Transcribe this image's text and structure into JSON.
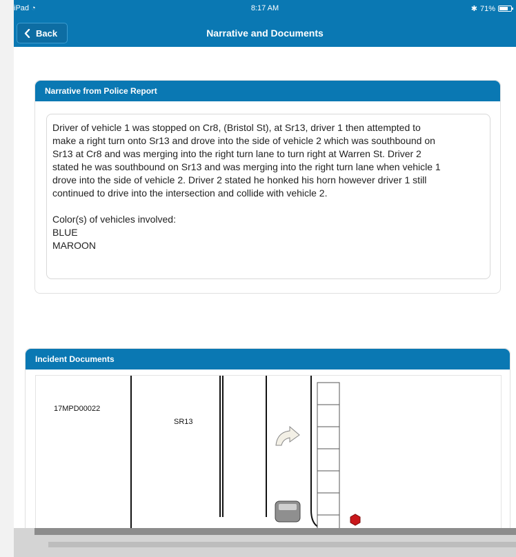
{
  "status_bar": {
    "device": "iPad",
    "time": "8:17 AM",
    "battery": "71%"
  },
  "nav": {
    "back_label": "Back",
    "title": "Narrative and Documents"
  },
  "narrative": {
    "header": "Narrative from Police Report",
    "paragraph_lines": [
      "Driver of vehicle 1 was stopped on Cr8, (Bristol St), at Sr13, driver 1 then attempted to",
      "make a right turn onto Sr13 and drove into the side of vehicle 2 which was southbound on",
      "Sr13 at Cr8 and was merging into the right turn lane to turn right at Warren St.  Driver 2",
      "stated he was southbound on Sr13 and was merging into the right turn lane when vehicle 1",
      "drove into the side of vehicle 2. Driver 2 stated he honked his horn however driver 1 still",
      "continued to drive into the intersection and collide with vehicle 2."
    ],
    "colors_label": "Color(s) of vehicles involved:",
    "colors": [
      "BLUE",
      "MAROON"
    ]
  },
  "documents": {
    "header": "Incident Documents",
    "doc_id": "17MPD00022",
    "road_label": "SR13"
  }
}
